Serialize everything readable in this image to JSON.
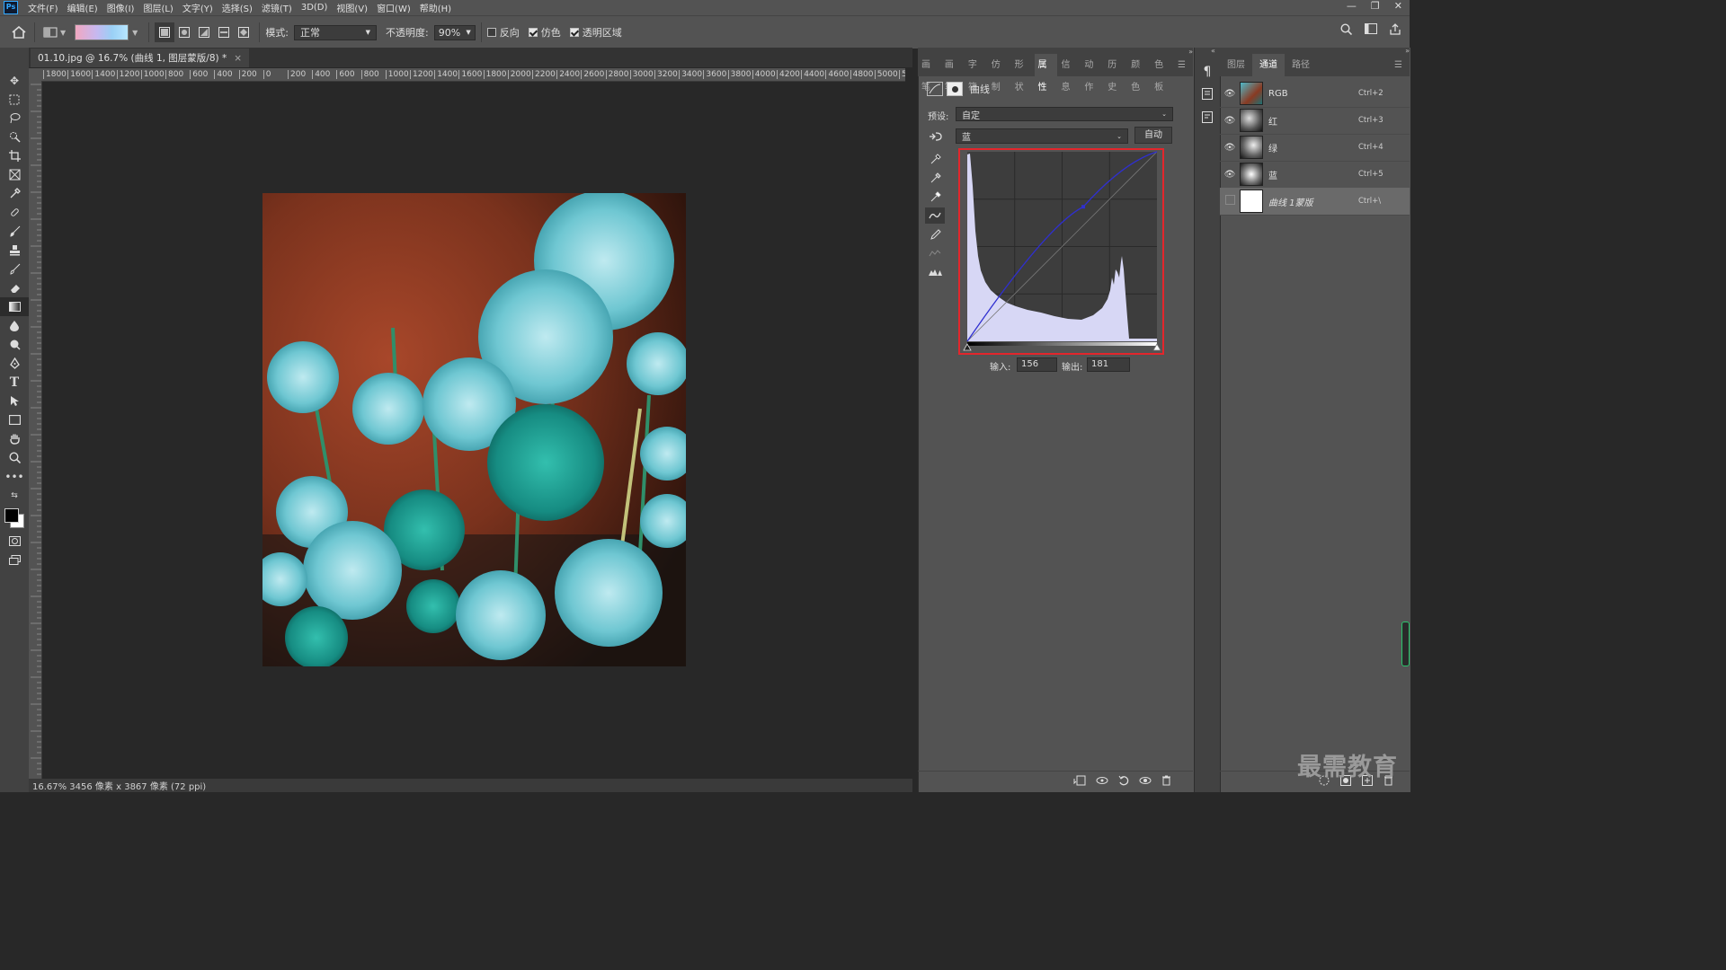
{
  "menubar": {
    "logo": "Ps",
    "items": [
      "文件(F)",
      "编辑(E)",
      "图像(I)",
      "图层(L)",
      "文字(Y)",
      "选择(S)",
      "滤镜(T)",
      "3D(D)",
      "视图(V)",
      "窗口(W)",
      "帮助(H)"
    ]
  },
  "options": {
    "mode_label": "模式:",
    "mode_value": "正常",
    "opacity_label": "不透明度:",
    "opacity_value": "90%",
    "reverse_label": "反向",
    "dither_label": "仿色",
    "transparency_label": "透明区域"
  },
  "document": {
    "tab_title": "01.10.jpg @ 16.7% (曲线 1, 图层蒙版/8) *",
    "close": "×",
    "ruler_ticks": [
      "1800",
      "1600",
      "1400",
      "1200",
      "1000",
      "800",
      "600",
      "400",
      "200",
      "0",
      "200",
      "400",
      "600",
      "800",
      "1000",
      "1200",
      "1400",
      "1600",
      "1800",
      "2000",
      "2200",
      "2400",
      "2600",
      "2800",
      "3000",
      "3200",
      "3400",
      "3600",
      "3800",
      "4000",
      "4200",
      "4400",
      "4600",
      "4800",
      "5000",
      "5"
    ],
    "status": "16.67%  3456 像素 x 3867 像素 (72 ppi)"
  },
  "properties": {
    "tabs": [
      "画笔",
      "画笔",
      "字符",
      "仿制",
      "形状",
      "属性",
      "信息",
      "动作",
      "历史",
      "颜色",
      "色板"
    ],
    "active_tab": "属性",
    "title": "曲线",
    "preset_label": "预设:",
    "preset_value": "自定",
    "channel_value": "蓝",
    "auto_button": "自动",
    "input_label": "输入:",
    "input_value": "156",
    "output_label": "输出:",
    "output_value": "181",
    "curve": {
      "input": 156,
      "output": 181,
      "channel_color": "#2f2fd0"
    }
  },
  "channels": {
    "tabs": [
      "图层",
      "通道",
      "路径"
    ],
    "active_tab": "通道",
    "rows": [
      {
        "name": "RGB",
        "shortcut": "Ctrl+2"
      },
      {
        "name": "红",
        "shortcut": "Ctrl+3"
      },
      {
        "name": "绿",
        "shortcut": "Ctrl+4"
      },
      {
        "name": "蓝",
        "shortcut": "Ctrl+5"
      },
      {
        "name": "曲线 1蒙版",
        "shortcut": "Ctrl+\\"
      }
    ]
  },
  "watermark": "最需教育",
  "colors": {
    "highlight": "#e3262c",
    "ui_dark": "#282828",
    "panel": "#535353"
  }
}
